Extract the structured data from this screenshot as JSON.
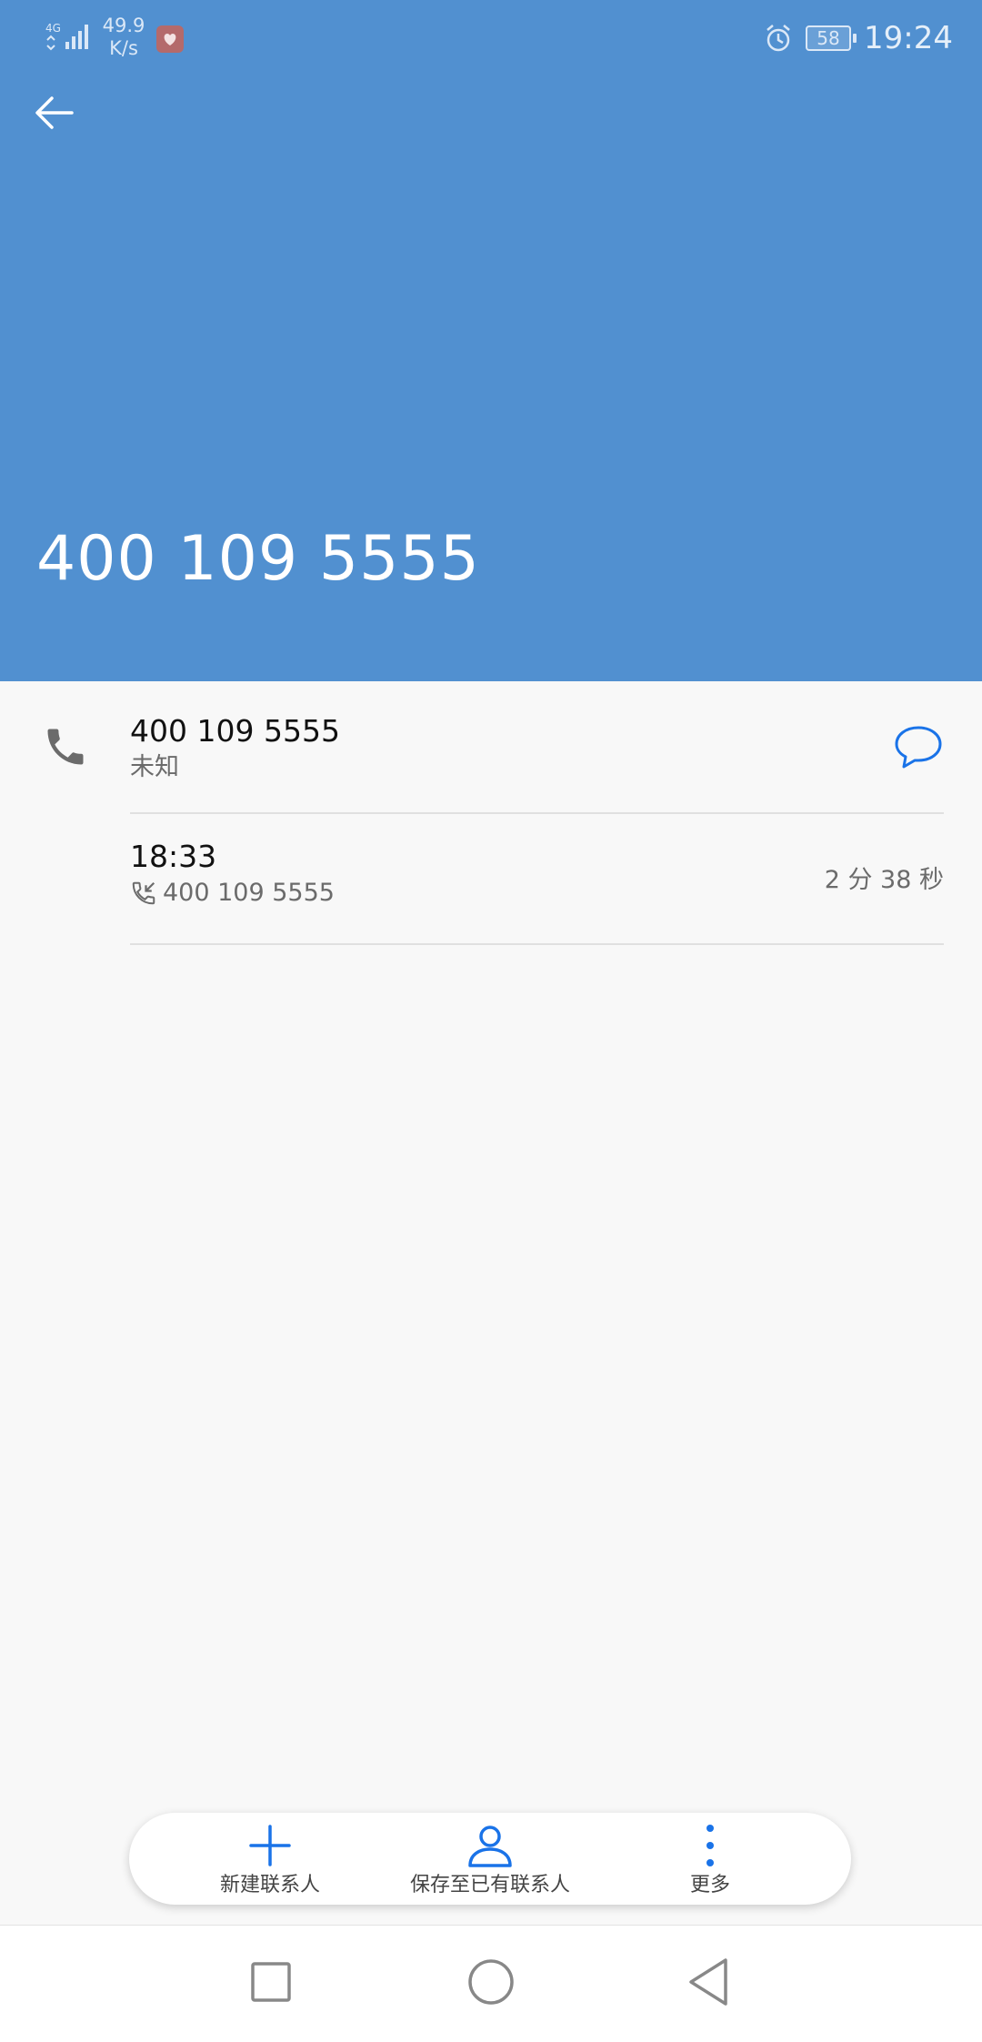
{
  "status_bar": {
    "network": "4G",
    "speed_value": "49.9",
    "speed_unit": "K/s",
    "battery": "58",
    "time": "19:24"
  },
  "header": {
    "title": "400 109 5555"
  },
  "contact": {
    "number": "400 109 5555",
    "location": "未知"
  },
  "call_log": [
    {
      "time": "18:33",
      "number": "400 109 5555",
      "duration": "2 分 38 秒"
    }
  ],
  "actions": [
    {
      "label": "新建联系人",
      "icon": "plus-icon"
    },
    {
      "label": "保存至已有联系人",
      "icon": "person-icon"
    },
    {
      "label": "更多",
      "icon": "more-vertical-icon"
    }
  ],
  "colors": {
    "header_bg": "#5190d0",
    "accent": "#1a73e8",
    "page_bg": "#f8f8f8"
  }
}
